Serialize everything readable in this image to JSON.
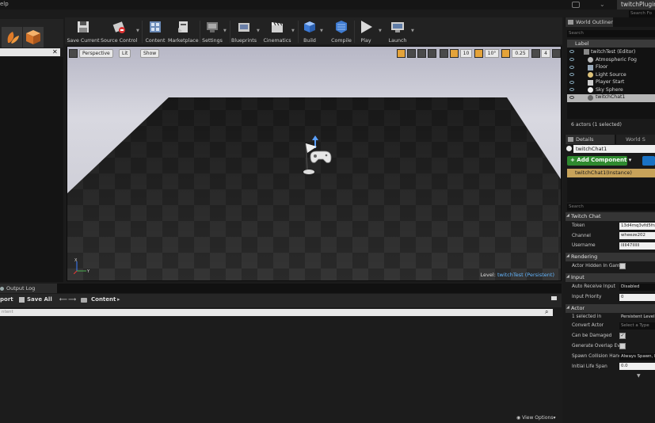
{
  "titlebar": {
    "menu_fragment": "elp",
    "project_tab": "twitchPlugin"
  },
  "top_search": "Search Fo",
  "toolbar": {
    "buttons": [
      {
        "label": "Save Current"
      },
      {
        "label": "Source Control"
      },
      {
        "label": "Content"
      },
      {
        "label": "Marketplace"
      },
      {
        "label": "Settings"
      },
      {
        "label": "Blueprints"
      },
      {
        "label": "Cinematics"
      },
      {
        "label": "Build"
      },
      {
        "label": "Compile"
      },
      {
        "label": "Play"
      },
      {
        "label": "Launch"
      }
    ]
  },
  "viewport": {
    "view_mode": "Perspective",
    "lit_mode": "Lit",
    "show_label": "Show",
    "grid_snap": "10",
    "rotation_snap": "10°",
    "scale_snap": "0.25",
    "camera_speed": "4",
    "level_label": "Level:",
    "level_name": "twitchTest (Persistent)",
    "axis_x": "X",
    "axis_y": "Y"
  },
  "content_browser": {
    "output_tab": "Output Log",
    "import_label": "port",
    "save_all_label": "Save All",
    "path_root": "Content",
    "search_placeholder": "ntent",
    "view_options": "View Options"
  },
  "world_outliner": {
    "tab_label": "World Outliner",
    "search_placeholder": "Search",
    "column_label": "Label",
    "items": [
      {
        "label": "twitchTest (Editor)"
      },
      {
        "label": "Atmospheric Fog"
      },
      {
        "label": "Floor"
      },
      {
        "label": "Light Source"
      },
      {
        "label": "Player Start"
      },
      {
        "label": "Sky Sphere"
      },
      {
        "label": "twitchChat1"
      }
    ],
    "count_text": "6 actors (1 selected)"
  },
  "details": {
    "tab_label": "Details",
    "tab2_label": "World S",
    "actor_name": "twitchChat1",
    "add_component": "+ Add Component",
    "instance_label": "twitchChat1(Instance)",
    "search_placeholder": "Search",
    "categories": {
      "twitch_chat": "Twitch Chat",
      "rendering": "Rendering",
      "input": "Input",
      "actor": "Actor"
    },
    "twitch_chat": [
      {
        "key": "Token",
        "value": "13d4mq3vfd5fra"
      },
      {
        "key": "Channel",
        "value": "wheeze202"
      },
      {
        "key": "Username",
        "value": "lllll47llllll"
      }
    ],
    "rendering": [
      {
        "key": "Actor Hidden In Game"
      }
    ],
    "input": [
      {
        "key": "Auto Receive Input",
        "value": "Disabled"
      },
      {
        "key": "Input Priority",
        "value": "0"
      }
    ],
    "actor": [
      {
        "key": "1 selected in",
        "value": "Persistent Level"
      },
      {
        "key": "Convert Actor",
        "value": "Select a Type"
      },
      {
        "key": "Can be Damaged",
        "value": "✓"
      },
      {
        "key": "Generate Overlap Eve",
        "value": ""
      },
      {
        "key": "Spawn Collision Hand",
        "value": "Always Spawn, Ig"
      },
      {
        "key": "Initial Life Span",
        "value": "0.0"
      }
    ]
  },
  "colors": {
    "accent_blue": "#65b7ff",
    "add_component_green": "#2f8a2f",
    "instance_gold": "#c8a35a",
    "snap_active_orange": "#e4a33a"
  }
}
